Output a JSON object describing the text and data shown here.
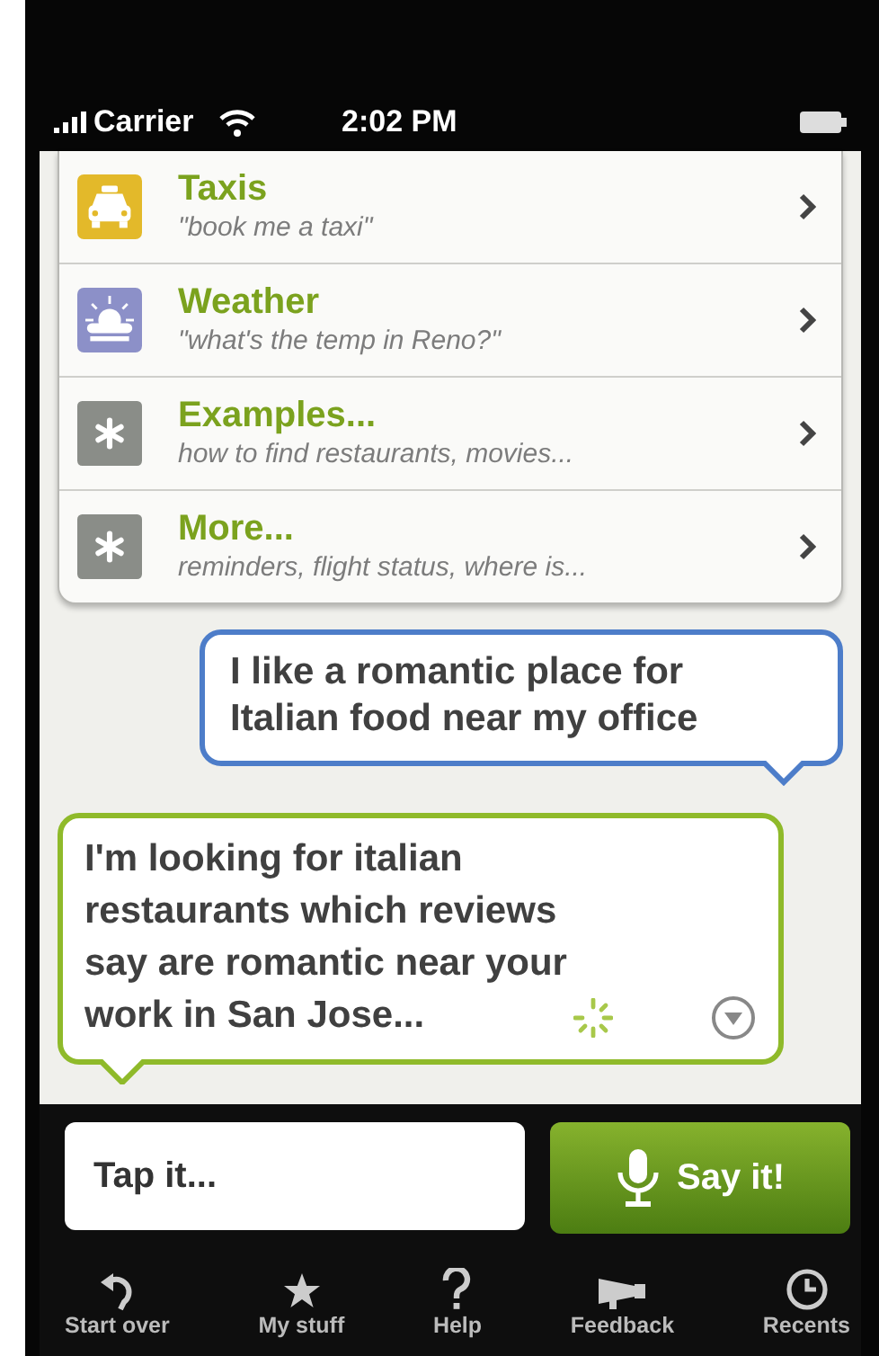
{
  "status_bar": {
    "carrier": "Carrier",
    "time": "2:02 PM"
  },
  "menu": [
    {
      "kind": "taxi",
      "title": "Taxis",
      "subtitle": "\"book me a taxi\""
    },
    {
      "kind": "weather",
      "title": "Weather",
      "subtitle": "\"what's the temp in Reno?\""
    },
    {
      "kind": "generic",
      "title": "Examples...",
      "subtitle": "how to find restaurants, movies..."
    },
    {
      "kind": "generic",
      "title": "More...",
      "subtitle": "reminders, flight status, where is..."
    }
  ],
  "conversation": [
    {
      "kind": "user",
      "text": "I like a romantic place for Italian food near my office"
    },
    {
      "kind": "assistant",
      "text": "I'm looking for **italian restaurants** which reviews say **are romantic** near **your work** in **San Jose**...",
      "busy": true
    }
  ],
  "input": {
    "placeholder": "Tap it...",
    "button": "Say it!"
  },
  "tabs": [
    {
      "kind": "undo",
      "label": "Start over"
    },
    {
      "kind": "star",
      "label": "My stuff"
    },
    {
      "kind": "help",
      "label": "Help"
    },
    {
      "kind": "megaphone",
      "label": "Feedback"
    },
    {
      "kind": "clock",
      "label": "Recents"
    }
  ]
}
